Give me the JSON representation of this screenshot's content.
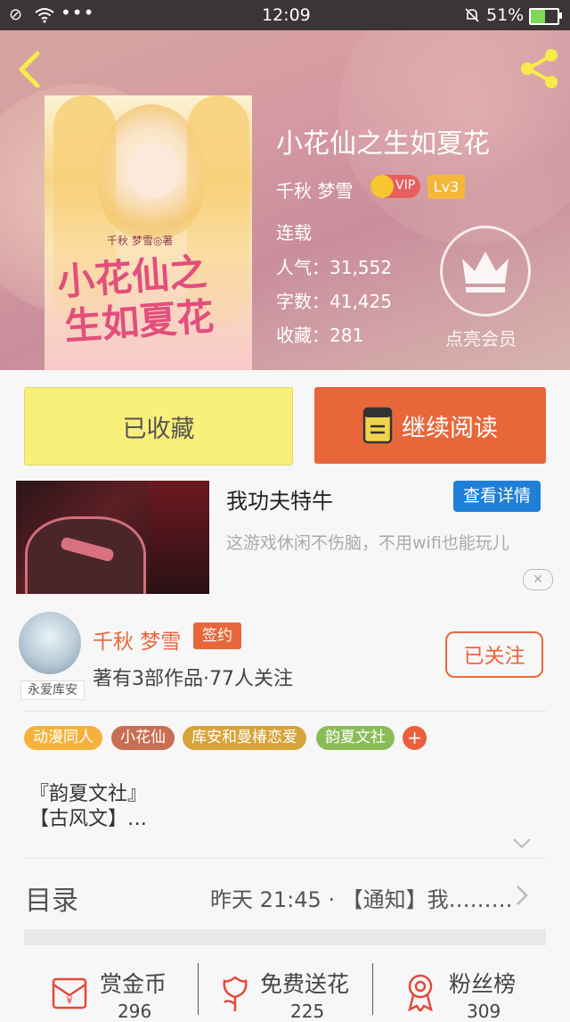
{
  "status": {
    "time": "12:09",
    "battery": "51%"
  },
  "book": {
    "title": "小花仙之生如夏花",
    "author": "千秋 梦雪",
    "vip_badge": "VIP",
    "level_badge": "Lv3",
    "state": "连载",
    "popularity": "人气：31,552",
    "words": "字数：41,425",
    "favorites": "收藏：281",
    "member_label": "点亮会员",
    "cover_author": "千秋 梦雪◎著",
    "cover_title_1": "小花仙之",
    "cover_title_2": "生如夏花"
  },
  "actions": {
    "collected": "已收藏",
    "continue": "继续阅读"
  },
  "ad": {
    "title": "我功夫特牛",
    "detail_btn": "查看详情",
    "desc": "这游戏休闲不伤脑，不用wifi也能玩儿"
  },
  "author_card": {
    "name": "千秋 梦雪",
    "sign_badge": "签约",
    "stats": "著有3部作品·77人关注",
    "avatar_label": "永爱库安",
    "follow_btn": "已关注"
  },
  "tags": [
    {
      "label": "动漫同人",
      "color": "#f4b23c"
    },
    {
      "label": "小花仙",
      "color": "#c86e52"
    },
    {
      "label": "库安和曼椿恋爱",
      "color": "#d7a33a"
    },
    {
      "label": "韵夏文社",
      "color": "#8bbb57"
    },
    {
      "label": "+",
      "color": "#e9603a"
    }
  ],
  "intro": {
    "line1": "『韵夏文社』",
    "line2": "【古风文】…"
  },
  "catalog": {
    "label": "目录",
    "latest": "昨天 21:45 · 【通知】我………"
  },
  "bottom": [
    {
      "label": "赏金币",
      "count": "296"
    },
    {
      "label": "免费送花",
      "count": "225"
    },
    {
      "label": "粉丝榜",
      "count": "309"
    }
  ],
  "colors": {
    "accent": "#e8673a",
    "yellow": "#f9f07a",
    "blue": "#1e7fd8"
  }
}
